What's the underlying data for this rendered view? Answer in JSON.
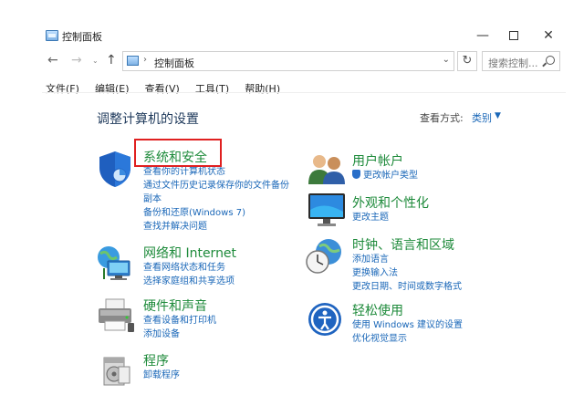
{
  "window": {
    "title": "控制面板",
    "minimize_glyph": "—",
    "close_glyph": "✕"
  },
  "nav": {
    "back_glyph": "←",
    "forward_glyph": "→",
    "recent_glyph": "⌄",
    "up_glyph": "↑",
    "address_sep": "›",
    "address_text": "控制面板",
    "address_dropdown_glyph": "⌄",
    "refresh_glyph": "↻",
    "search_placeholder": "搜索控制..."
  },
  "menu": [
    "文件(F)",
    "编辑(E)",
    "查看(V)",
    "工具(T)",
    "帮助(H)"
  ],
  "main": {
    "title": "调整计算机的设置",
    "view_by_label": "查看方式:",
    "view_by_value": "类别",
    "view_by_chevron": "▼"
  },
  "categories_left": [
    {
      "title": "系统和安全",
      "icon": "shield-icon",
      "links": [
        "查看你的计算机状态",
        "通过文件历史记录保存你的文件备份",
        "副本",
        "备份和还原(Windows 7)",
        "查找并解决问题"
      ]
    },
    {
      "title": "网络和 Internet",
      "icon": "network-icon",
      "links": [
        "查看网络状态和任务",
        "选择家庭组和共享选项"
      ]
    },
    {
      "title": "硬件和声音",
      "icon": "printer-icon",
      "links": [
        "查看设备和打印机",
        "添加设备"
      ]
    },
    {
      "title": "程序",
      "icon": "programs-icon",
      "links": [
        "卸载程序"
      ]
    }
  ],
  "categories_right": [
    {
      "title": "用户帐户",
      "icon": "users-icon",
      "links": [
        "更改帐户类型"
      ]
    },
    {
      "title": "外观和个性化",
      "icon": "monitor-icon",
      "links": [
        "更改主题"
      ]
    },
    {
      "title": "时钟、语言和区域",
      "icon": "clock-globe-icon",
      "links": [
        "添加语言",
        "更换输入法",
        "更改日期、时间或数字格式"
      ]
    },
    {
      "title": "轻松使用",
      "icon": "accessibility-icon",
      "links": [
        "使用 Windows 建议的设置",
        "优化视觉显示"
      ]
    }
  ]
}
